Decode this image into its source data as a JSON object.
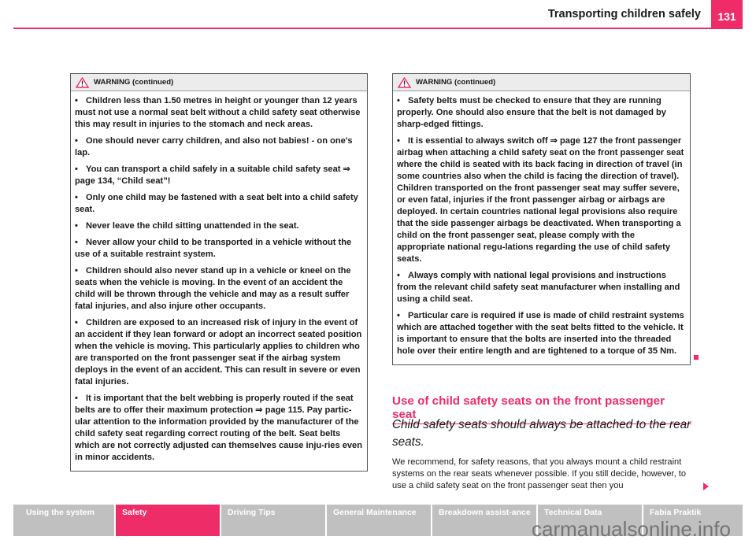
{
  "header": {
    "title": "Transporting children safely",
    "page_number": "131",
    "accent_color": "#ee2d68"
  },
  "left_warning": {
    "icon": "warning-triangle-icon",
    "title": "WARNING (continued)",
    "bullets": [
      "Children less than 1.50 metres in height or younger than 12 years must not use a normal seat belt without a child safety seat otherwise this may result in injuries to the stomach and neck areas.",
      "One should never carry children, and also not babies! - on one's lap.",
      "You can transport a child safely in a suitable child safety seat ⇒ page 134, “Child seat”!",
      "Only one child may be fastened with a seat belt into a child safety seat.",
      "Never leave the child sitting unattended in the seat.",
      "Never allow your child to be transported in a vehicle without the use of a suitable restraint system.",
      "Children should also never stand up in a vehicle or kneel on the seats when the vehicle is moving. In the event of an accident the child will be thrown through the vehicle and may as a result suffer fatal injuries, and also injure other occupants.",
      "Children are exposed to an increased risk of injury in the event of an accident if they lean forward or adopt an incorrect seated position when the vehicle is moving. This particularly applies to children who are transported on the front passenger seat if the airbag system deploys in the event of an accident. This can result in severe or even fatal injuries.",
      "It is important that the belt webbing is properly routed if the seat belts are to offer their maximum protection ⇒ page 115. Pay partic-ular attention to the information provided by the manufacturer of the child safety seat regarding correct routing of the belt. Seat belts which are not correctly adjusted can themselves cause inju-ries even in minor accidents."
    ]
  },
  "right_warning": {
    "icon": "warning-triangle-icon",
    "title": "WARNING (continued)",
    "bullets": [
      "Safety belts must be checked to ensure that they are running properly. One should also ensure that the belt is not damaged by sharp-edged fittings.",
      "It is essential to always switch off ⇒ page 127 the front passenger airbag when attaching a child safety seat on the front passenger seat where the child is seated with its back facing in direction of travel (in some countries also when the child is facing the direction of travel). Children transported on the front passenger seat may suffer severe, or even fatal, injuries if the front passenger airbag or airbags are deployed. In certain countries national legal provisions also require that the side passenger airbags be deactivated. When transporting a child on the front passenger seat, please comply with the appropriate national regu-lations regarding the use of child safety seats.",
      "Always comply with national legal provisions and instructions from the relevant child safety seat manufacturer when installing and using a child seat.",
      "Particular care is required if use is made of child restraint systems which are attached together with the seat belts fitted to the vehicle. It is important to ensure that the bolts are inserted into the threaded hole over their entire length and are tightened to a torque of 35 Nm."
    ]
  },
  "section": {
    "title": "Use of child safety seats on the front passenger seat",
    "subtitle": "Child safety seats should always be attached to the rear seats.",
    "body": "We recommend, for safety reasons, that you always mount a child restraint systems on the rear seats whenever possible. If you still decide, however, to use a child safety seat on the front passenger seat then you"
  },
  "nav": {
    "tabs": [
      {
        "label": "Using the system",
        "active": false
      },
      {
        "label": "Safety",
        "active": true
      },
      {
        "label": "Driving Tips",
        "active": false
      },
      {
        "label": "General Maintenance",
        "active": false
      },
      {
        "label": "Breakdown assist-ance",
        "active": false
      },
      {
        "label": "Technical Data",
        "active": false
      },
      {
        "label": "Fabia Praktik",
        "active": false
      }
    ]
  },
  "watermark": "carmanualsonline.info"
}
